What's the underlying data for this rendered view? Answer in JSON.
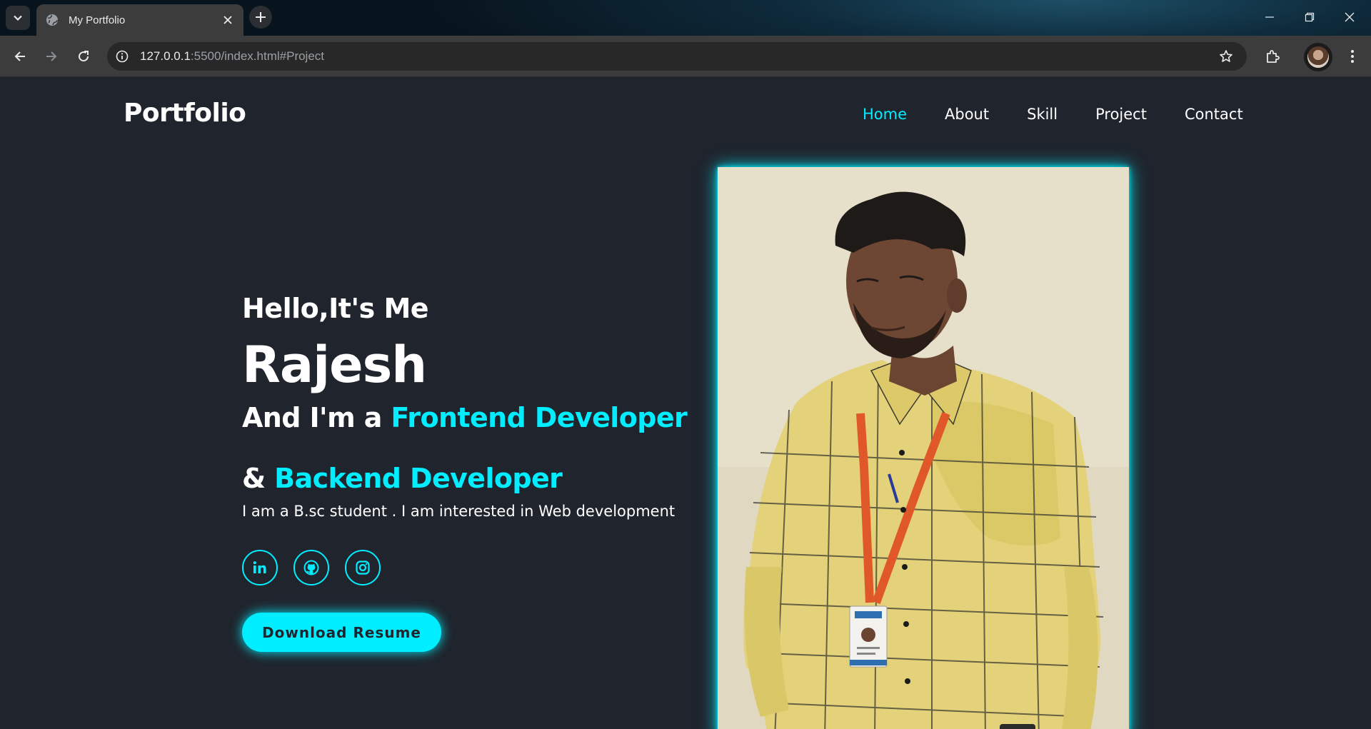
{
  "browser": {
    "tab_title": "My Portfolio",
    "url_host": "127.0.0.1",
    "url_rest": ":5500/index.html#Project",
    "icons": [
      "tab-search-icon",
      "globe-icon",
      "close-icon",
      "plus-icon",
      "minimize-icon",
      "restore-icon",
      "close-window-icon",
      "back-arrow-icon",
      "forward-arrow-icon",
      "reload-icon",
      "site-info-icon",
      "star-icon",
      "extensions-icon",
      "profile-avatar",
      "more-vert-icon"
    ]
  },
  "header": {
    "logo": "Portfolio",
    "nav": [
      {
        "label": "Home",
        "active": true
      },
      {
        "label": "About",
        "active": false
      },
      {
        "label": "Skill",
        "active": false
      },
      {
        "label": "Project",
        "active": false
      },
      {
        "label": "Contact",
        "active": false
      }
    ]
  },
  "hero": {
    "greeting": "Hello,It's Me",
    "name": "Rajesh",
    "role_prefix": "And I'm a ",
    "role_1": "Frontend Developer",
    "role_2_prefix": "& ",
    "role_2": "Backend Developer",
    "description": "I am a B.sc student . I am interested in Web development",
    "socials": [
      "linkedin-icon",
      "github-icon",
      "instagram-icon"
    ],
    "button": "Download Resume"
  },
  "colors": {
    "accent": "#00eeff",
    "background": "#1f242d",
    "text": "#ffffff"
  }
}
